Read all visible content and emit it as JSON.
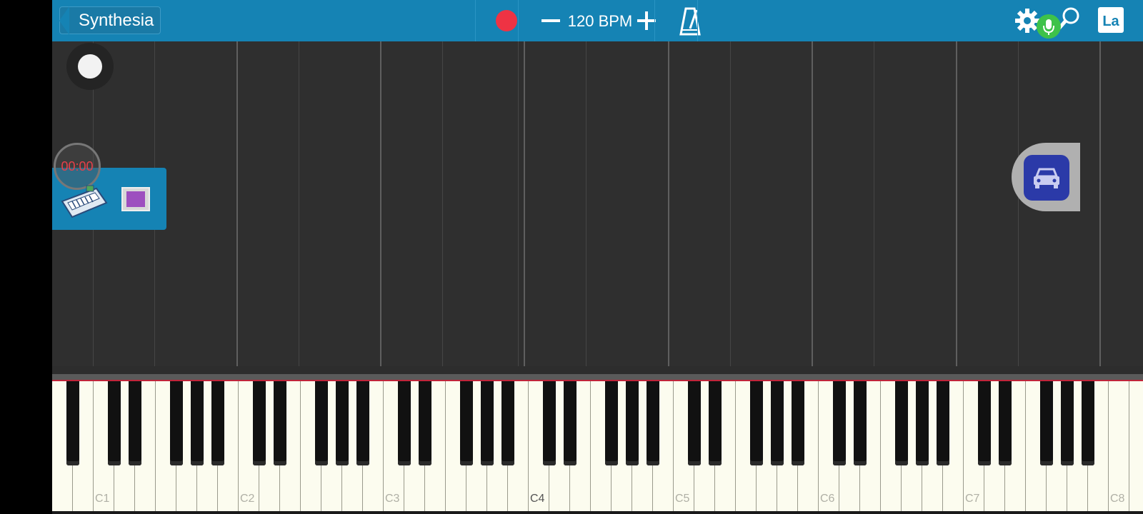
{
  "toolbar": {
    "back_label": "Synthesia",
    "bpm_label": "120 BPM",
    "language_label": "La"
  },
  "stage": {
    "timer": "00:00"
  },
  "keyboard": {
    "octave_labels": [
      "C1",
      "C2",
      "C3",
      "C4",
      "C5",
      "C6",
      "C7",
      "C8"
    ],
    "highlighted_label": "C4"
  },
  "colors": {
    "toolbar": "#1583b4",
    "record": "#ee3344",
    "mic_badge": "#3ec24a",
    "timer_text": "#e8404a",
    "car_button": "#2b3aa8"
  },
  "icons": [
    "back-chevron-icon",
    "record-icon",
    "minus-icon",
    "plus-icon",
    "metronome-icon",
    "gear-icon",
    "microphone-icon",
    "search-icon",
    "keyboard-icon",
    "screen-icon",
    "car-icon"
  ]
}
